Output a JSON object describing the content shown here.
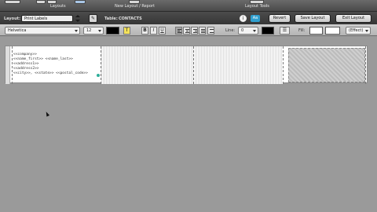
{
  "top_bar": {
    "sections": [
      "Layouts",
      "New Layout / Report",
      "Layout Tools"
    ]
  },
  "layout_bar": {
    "layout_label": "Layout:",
    "layout_value": "Print Labels",
    "table_label": "Table:",
    "table_value": "CONTACTS",
    "info_glyph": "i",
    "aa_label": "Aa",
    "revert_label": "Revert",
    "save_label": "Save Layout",
    "exit_label": "Exit Layout"
  },
  "format_bar": {
    "font_value": "Helvetica",
    "size_value": "12",
    "text_color": "#000000",
    "highlight_glyph": "T",
    "bold_glyph": "B",
    "italic_glyph": "I",
    "underline_glyph": "U",
    "line_label": "Line:",
    "line_value": "0",
    "line_color": "#000000",
    "fill_label": "Fill:",
    "effect_value": "(Effect)"
  },
  "label_fields": {
    "company": "<<company>>",
    "name": "<<name_first>> <<name_last>>",
    "address1": "<<address1>>",
    "address2": "<<address2>>",
    "city_line": "<<city>>, <<state>> <<postal_code>>"
  }
}
